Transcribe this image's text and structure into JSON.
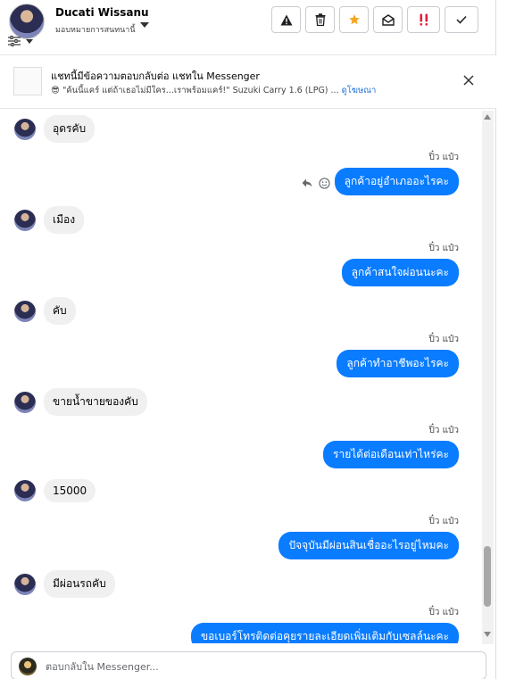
{
  "header": {
    "contact_name": "Ducati Wissanu",
    "assign_label": "มอบหมายการสนทนานี้",
    "actions": [
      {
        "name": "report-spam-button",
        "icon": "warning-icon"
      },
      {
        "name": "delete-button",
        "icon": "trash-icon"
      },
      {
        "name": "star-button",
        "icon": "star-icon"
      },
      {
        "name": "mark-unread-button",
        "icon": "envelope-open-icon"
      },
      {
        "name": "flag-button",
        "icon": "exclamation-icon"
      },
      {
        "name": "mark-done-button",
        "icon": "check-icon"
      }
    ]
  },
  "banner": {
    "title": "แชทนี้มีข้อความตอบกลับต่อ แชทใน Messenger",
    "subtitle_emoji": "😎",
    "subtitle": "\"ค้นนี้แคร์ แต่ถ้าเธอไม่มีใคร...เราพร้อมแคร์!\" Suzuki Carry 1.6 (LPG) ...",
    "link": "ดูโฆษณา"
  },
  "messages": {
    "in_1": "อุดรคับ",
    "sender_1": "ปิ๋ว แป๋ว",
    "out_1": "ลูกค้าอยู่อำเภออะไรคะ",
    "in_2": "เมือง",
    "sender_2": "ปิ๋ว แป๋ว",
    "out_2": "ลูกค้าสนใจผ่อนนะคะ",
    "in_3": "คับ",
    "sender_3": "ปิ๋ว แป๋ว",
    "out_3": "ลูกค้าทำอาชีพอะไรคะ",
    "in_4": "ขายน้ำขายของคับ",
    "sender_4": "ปิ๋ว แป๋ว",
    "out_4": "รายได้ต่อเดือนเท่าไหร่คะ",
    "in_5": "15000",
    "sender_5": "ปิ๋ว แป๋ว",
    "out_5": "ปัจจุบันมีผ่อนสินเชื่ออะไรอยู่ไหมคะ",
    "in_6": "มีผ่อนรถคับ",
    "sender_6": "ปิ๋ว แป๋ว",
    "out_6": "ขอเบอร์โทรติดต่อคุยรายละเอียดเพิ่มเติมกับเซลล์นะคะ"
  },
  "composer": {
    "placeholder": "ตอบกลับใน Messenger..."
  },
  "colors": {
    "outgoing_bubble": "#0a7cff",
    "incoming_bubble": "#f0f0f0",
    "star": "#f5a623",
    "flag": "#e41e3f"
  }
}
